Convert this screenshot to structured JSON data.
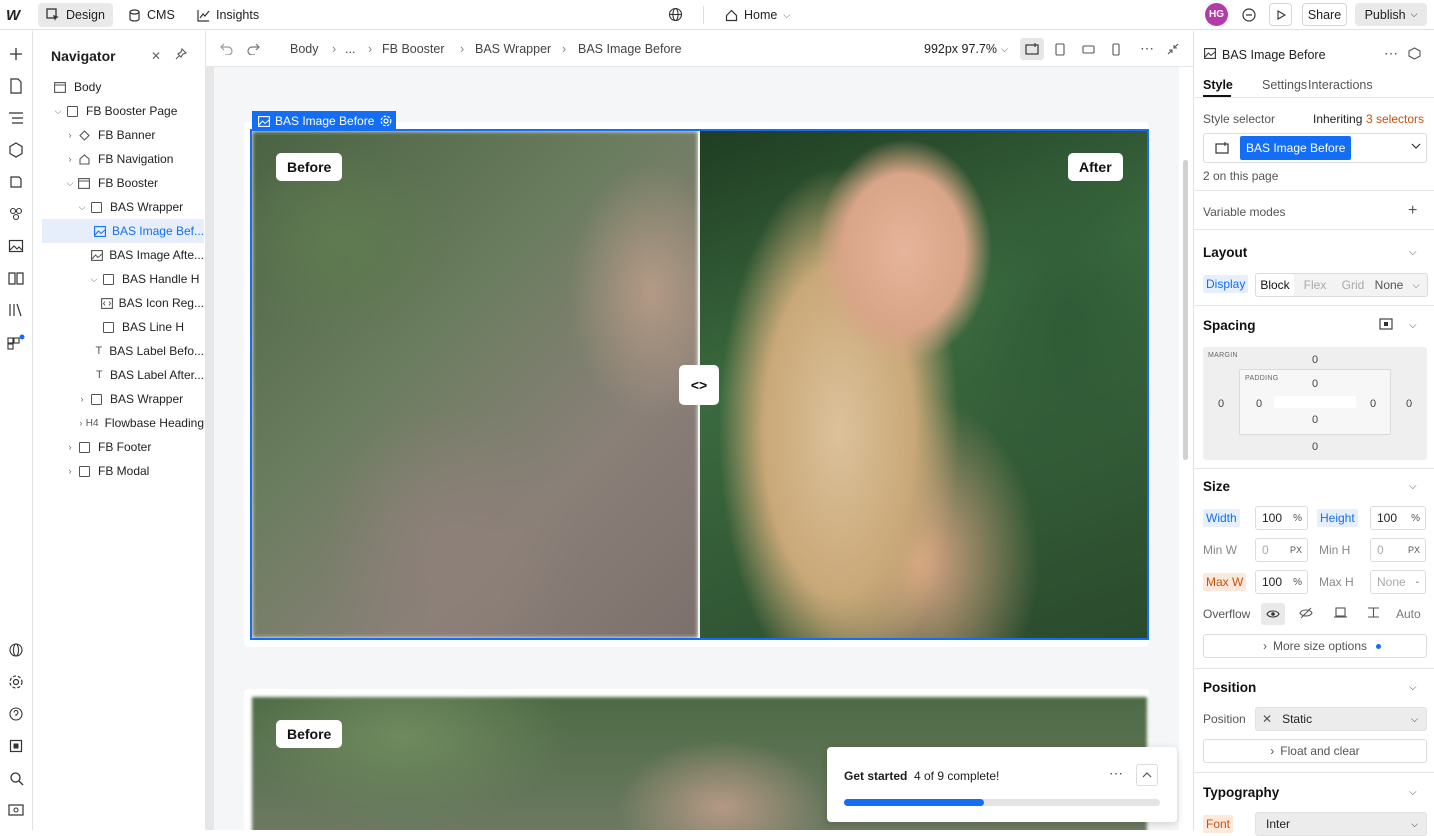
{
  "topbar": {
    "logo": "W",
    "design_label": "Design",
    "cms_label": "CMS",
    "insights_label": "Insights",
    "page_label": "Home",
    "avatar_initials": "HG",
    "share_label": "Share",
    "publish_label": "Publish"
  },
  "navigator": {
    "title": "Navigator",
    "items": [
      {
        "label": "Body"
      },
      {
        "label": "FB Booster Page"
      },
      {
        "label": "FB Banner"
      },
      {
        "label": "FB Navigation"
      },
      {
        "label": "FB Booster"
      },
      {
        "label": "BAS Wrapper"
      },
      {
        "label": "BAS Image Bef..."
      },
      {
        "label": "BAS Image Afte..."
      },
      {
        "label": "BAS Handle H"
      },
      {
        "label": "BAS Icon Reg..."
      },
      {
        "label": "BAS Line H"
      },
      {
        "label": "BAS Label Befo..."
      },
      {
        "label": "BAS Label After..."
      },
      {
        "label": "BAS Wrapper"
      },
      {
        "label": "Flowbase Heading"
      },
      {
        "label": "FB Footer"
      },
      {
        "label": "FB Modal"
      }
    ]
  },
  "breadcrumb": {
    "items": [
      "Body",
      "...",
      "FB Booster",
      "BAS Wrapper",
      "BAS Image Before"
    ],
    "viewport": "992px 97.7%"
  },
  "canvas": {
    "selected_tag": "BAS Image Before",
    "before_label": "Before",
    "after_label": "After",
    "handle_glyph": "<>",
    "second_before_label": "Before"
  },
  "get_started": {
    "title": "Get started",
    "progress_text": "4 of 9 complete!",
    "progress": 0.444
  },
  "right_panel": {
    "element_name": "BAS Image Before",
    "tabs": [
      "Style",
      "Settings",
      "Interactions"
    ],
    "style_selector_label": "Style selector",
    "inheriting_prefix": "Inheriting",
    "inheriting_count": "3 selectors",
    "selector_chip": "BAS Image Before",
    "on_page": "2 on this page",
    "variable_modes": "Variable modes",
    "layout": {
      "title": "Layout",
      "display_label": "Display",
      "options": [
        "Block",
        "Flex",
        "Grid",
        "None"
      ]
    },
    "spacing": {
      "title": "Spacing",
      "margin_label": "MARGIN",
      "padding_label": "PADDING",
      "margin_top": "0",
      "margin_right": "0",
      "margin_bottom": "0",
      "margin_left": "0",
      "padding_top": "0",
      "padding_right": "0",
      "padding_bottom": "0",
      "padding_left": "0"
    },
    "size": {
      "title": "Size",
      "width_label": "Width",
      "width_value": "100",
      "width_unit": "%",
      "height_label": "Height",
      "height_value": "100",
      "height_unit": "%",
      "minw_label": "Min W",
      "minw_value": "0",
      "minw_unit": "PX",
      "minh_label": "Min H",
      "minh_value": "0",
      "minh_unit": "PX",
      "maxw_label": "Max W",
      "maxw_value": "100",
      "maxw_unit": "%",
      "maxh_label": "Max H",
      "maxh_value": "None",
      "maxh_unit": "-",
      "overflow_label": "Overflow",
      "overflow_auto": "Auto",
      "more_options": "More size options"
    },
    "position": {
      "title": "Position",
      "label": "Position",
      "value": "Static",
      "float_label": "Float and clear"
    },
    "typography": {
      "title": "Typography",
      "font_label": "Font",
      "font_value": "Inter"
    }
  },
  "colors": {
    "accent": "#146ef5",
    "override": "#c6510f"
  }
}
